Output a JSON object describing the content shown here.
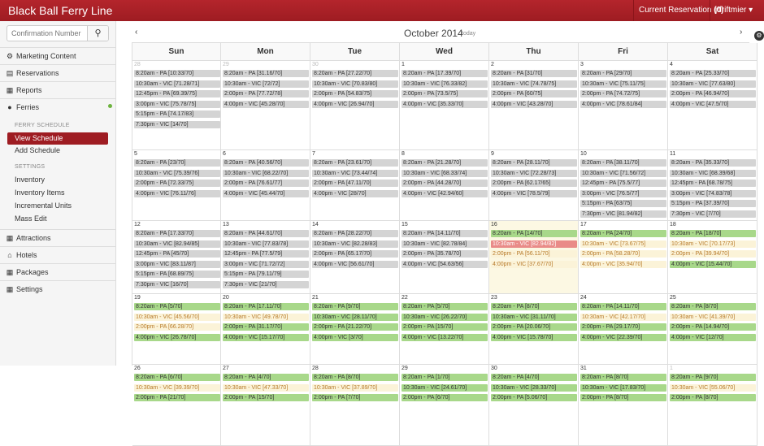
{
  "header": {
    "brand": "Black Ball Ferry Line",
    "reservation_label": "Current Reservation",
    "reservation_count": "(0)",
    "user": "jdriftmier ▾"
  },
  "search": {
    "placeholder": "Confirmation Number"
  },
  "sidebar": {
    "items": [
      {
        "label": "Marketing Content",
        "icon": "gear-icon"
      },
      {
        "label": "Reservations",
        "icon": "list-icon"
      },
      {
        "label": "Reports",
        "icon": "report-icon"
      },
      {
        "label": "Ferries",
        "icon": "drop-icon"
      }
    ],
    "ferry_schedule_heading": "FERRY SCHEDULE",
    "ferry_schedule": [
      "View Schedule",
      "Add Schedule"
    ],
    "settings_heading": "SETTINGS",
    "settings": [
      "Inventory",
      "Inventory Items",
      "Incremental Units",
      "Mass Edit"
    ],
    "bottom_items": [
      {
        "label": "Attractions",
        "icon": "grid-icon"
      },
      {
        "label": "Hotels",
        "icon": "home-icon"
      },
      {
        "label": "Packages",
        "icon": "grid-icon"
      },
      {
        "label": "Settings",
        "icon": "grid-icon"
      }
    ]
  },
  "calendar": {
    "title": "October 2014",
    "today_label": "today",
    "prev": "‹",
    "next": "›",
    "days": [
      "Sun",
      "Mon",
      "Tue",
      "Wed",
      "Thu",
      "Fri",
      "Sat"
    ],
    "weeks": [
      [
        {
          "n": "28",
          "other": true,
          "ev": [
            [
              "8:20am - PA [10:33/70]",
              "g"
            ],
            [
              "10:30am - VIC [71.28/71]",
              "g"
            ],
            [
              "12:45pm - PA [69.39/75]",
              "g"
            ],
            [
              "3:00pm - VIC [75.78/75]",
              "g"
            ],
            [
              "5:15pm - PA [74.17/83]",
              "g"
            ],
            [
              "7:30pm - VIC [14/70]",
              "g"
            ]
          ]
        },
        {
          "n": "29",
          "other": true,
          "ev": [
            [
              "8:20am - PA [31.16/70]",
              "g"
            ],
            [
              "10:30am - VIC [72/72]",
              "g"
            ],
            [
              "2:00pm - PA [77.72/78]",
              "g"
            ],
            [
              "4:00pm - VIC [45.28/70]",
              "g"
            ]
          ]
        },
        {
          "n": "30",
          "other": true,
          "ev": [
            [
              "8:20am - PA [27.22/70]",
              "g"
            ],
            [
              "10:30am - VIC [70.83/80]",
              "g"
            ],
            [
              "2:00pm - PA [54.83/75]",
              "g"
            ],
            [
              "4:00pm - VIC [26.94/70]",
              "g"
            ]
          ]
        },
        {
          "n": "1",
          "ev": [
            [
              "8:20am - PA [17.39/70]",
              "g"
            ],
            [
              "10:30am - VIC [76.33/82]",
              "g"
            ],
            [
              "2:00pm - PA [73.5/75]",
              "g"
            ],
            [
              "4:00pm - VIC [35.33/70]",
              "g"
            ]
          ]
        },
        {
          "n": "2",
          "ev": [
            [
              "8:20am - PA [31/70]",
              "g"
            ],
            [
              "10:30am - VIC [74.78/75]",
              "g"
            ],
            [
              "2:00pm - PA [60/75]",
              "g"
            ],
            [
              "4:00pm - VIC [43.28/70]",
              "g"
            ]
          ]
        },
        {
          "n": "3",
          "ev": [
            [
              "8:20am - PA [29/70]",
              "g"
            ],
            [
              "10:30am - VIC [75.11/75]",
              "g"
            ],
            [
              "2:00pm - PA [74.72/75]",
              "g"
            ],
            [
              "4:00pm - VIC [78.61/84]",
              "g"
            ]
          ]
        },
        {
          "n": "4",
          "ev": [
            [
              "8:20am - PA [25.33/70]",
              "g"
            ],
            [
              "10:30am - VIC [77.63/80]",
              "g"
            ],
            [
              "2:00pm - PA [46.94/70]",
              "g"
            ],
            [
              "4:00pm - VIC [47.5/70]",
              "g"
            ]
          ]
        }
      ],
      [
        {
          "n": "5",
          "ev": [
            [
              "8:20am - PA [23/70]",
              "g"
            ],
            [
              "10:30am - VIC [75.39/76]",
              "g"
            ],
            [
              "2:00pm - PA [72.33/75]",
              "g"
            ],
            [
              "4:00pm - VIC [76.11/76]",
              "g"
            ]
          ]
        },
        {
          "n": "6",
          "ev": [
            [
              "8:20am - PA [40.56/70]",
              "g"
            ],
            [
              "10:30am - VIC [68.22/70]",
              "g"
            ],
            [
              "2:00pm - PA [76.61/77]",
              "g"
            ],
            [
              "4:00pm - VIC [45.44/70]",
              "g"
            ]
          ]
        },
        {
          "n": "7",
          "ev": [
            [
              "8:20am - PA [23.61/70]",
              "g"
            ],
            [
              "10:30am - VIC [73.44/74]",
              "g"
            ],
            [
              "2:00pm - PA [47.11/70]",
              "g"
            ],
            [
              "4:00pm - VIC [28/70]",
              "g"
            ]
          ]
        },
        {
          "n": "8",
          "ev": [
            [
              "8:20am - PA [21.28/70]",
              "g"
            ],
            [
              "10:30am - VIC [68.33/74]",
              "g"
            ],
            [
              "2:00pm - PA [44.28/70]",
              "g"
            ],
            [
              "4:00pm - VIC [42.94/60]",
              "g"
            ]
          ]
        },
        {
          "n": "9",
          "ev": [
            [
              "8:20am - PA [28.11/70]",
              "g"
            ],
            [
              "10:30am - VIC [72.28/73]",
              "g"
            ],
            [
              "2:00pm - PA [62.17/65]",
              "g"
            ],
            [
              "4:00pm - VIC [78.5/79]",
              "g"
            ]
          ]
        },
        {
          "n": "10",
          "ev": [
            [
              "8:20am - PA [38.11/70]",
              "g"
            ],
            [
              "10:30am - VIC [71.56/72]",
              "g"
            ],
            [
              "12:45pm - PA [75.5/77]",
              "g"
            ],
            [
              "3:00pm - VIC [76.5/77]",
              "g"
            ],
            [
              "5:15pm - PA [63/75]",
              "g"
            ],
            [
              "7:30pm - VIC [81.94/82]",
              "g"
            ]
          ]
        },
        {
          "n": "11",
          "ev": [
            [
              "8:20am - PA [35.33/70]",
              "g"
            ],
            [
              "10:30am - VIC [68.39/68]",
              "g"
            ],
            [
              "12:45pm - PA [68.78/75]",
              "g"
            ],
            [
              "3:00pm - VIC [74.83/78]",
              "g"
            ],
            [
              "5:15pm - PA [37.39/70]",
              "g"
            ],
            [
              "7:30pm - VIC [7/70]",
              "g"
            ]
          ]
        }
      ],
      [
        {
          "n": "12",
          "ev": [
            [
              "8:20am - PA [17.33/70]",
              "g"
            ],
            [
              "10:30am - VIC [82.94/85]",
              "g"
            ],
            [
              "12:45pm - PA [45/70]",
              "g"
            ],
            [
              "3:00pm - VIC [83.11/87]",
              "g"
            ],
            [
              "5:15pm - PA [68.89/75]",
              "g"
            ],
            [
              "7:30pm - VIC [16/70]",
              "g"
            ]
          ]
        },
        {
          "n": "13",
          "ev": [
            [
              "8:20am - PA [44.61/70]",
              "g"
            ],
            [
              "10:30am - VIC [77.83/78]",
              "g"
            ],
            [
              "12:45pm - PA [77.5/79]",
              "g"
            ],
            [
              "3:00pm - VIC [71.72/72]",
              "g"
            ],
            [
              "5:15pm - PA [79.11/79]",
              "g"
            ],
            [
              "7:30pm - VIC [21/70]",
              "g"
            ]
          ]
        },
        {
          "n": "14",
          "ev": [
            [
              "8:20am - PA [28.22/70]",
              "g"
            ],
            [
              "10:30am - VIC [82.28/83]",
              "g"
            ],
            [
              "2:00pm - PA [65.17/70]",
              "g"
            ],
            [
              "4:00pm - VIC [56.61/70]",
              "g"
            ]
          ]
        },
        {
          "n": "15",
          "ev": [
            [
              "8:20am - PA [14.11/70]",
              "g"
            ],
            [
              "10:30am - VIC [82.78/84]",
              "g"
            ],
            [
              "2:00pm - PA [35.78/70]",
              "g"
            ],
            [
              "4:00pm - VIC [54.63/56]",
              "g"
            ]
          ]
        },
        {
          "n": "16",
          "today": true,
          "ev": [
            [
              "8:20am - PA [14/70]",
              "gr"
            ],
            [
              "10:30am - VIC [82.94/82]",
              "r"
            ],
            [
              "2:00pm - PA [56.11/70]",
              "c"
            ],
            [
              "4:00pm - VIC [37.67/70]",
              "c"
            ]
          ]
        },
        {
          "n": "17",
          "ev": [
            [
              "8:20am - PA [24/70]",
              "gr"
            ],
            [
              "10:30am - VIC [73.67/75]",
              "c"
            ],
            [
              "2:00pm - PA [58.28/70]",
              "c"
            ],
            [
              "4:00pm - VIC [35.94/70]",
              "c"
            ]
          ]
        },
        {
          "n": "18",
          "ev": [
            [
              "8:20am - PA [18/70]",
              "gr"
            ],
            [
              "10:30am - VIC [70.17/73]",
              "c"
            ],
            [
              "2:00pm - PA [39.94/70]",
              "c"
            ],
            [
              "4:00pm - VIC [15.44/70]",
              "gr"
            ]
          ]
        }
      ],
      [
        {
          "n": "19",
          "ev": [
            [
              "8:20am - PA [5/70]",
              "gr"
            ],
            [
              "10:30am - VIC [45.56/70]",
              "c"
            ],
            [
              "2:00pm - PA [66.28/70]",
              "c"
            ],
            [
              "4:00pm - VIC [26.78/70]",
              "gr"
            ]
          ]
        },
        {
          "n": "20",
          "ev": [
            [
              "8:20am - PA [17.11/70]",
              "gr"
            ],
            [
              "10:30am - VIC [49.78/70]",
              "c"
            ],
            [
              "2:00pm - PA [31.17/70]",
              "gr"
            ],
            [
              "4:00pm - VIC [15.17/70]",
              "gr"
            ]
          ]
        },
        {
          "n": "21",
          "ev": [
            [
              "8:20am - PA [9/70]",
              "gr"
            ],
            [
              "10:30am - VIC [28.11/70]",
              "gr"
            ],
            [
              "2:00pm - PA [21.22/70]",
              "gr"
            ],
            [
              "4:00pm - VIC [3/70]",
              "gr"
            ]
          ]
        },
        {
          "n": "22",
          "ev": [
            [
              "8:20am - PA [5/70]",
              "gr"
            ],
            [
              "10:30am - VIC [26.22/70]",
              "gr"
            ],
            [
              "2:00pm - PA [15/70]",
              "gr"
            ],
            [
              "4:00pm - VIC [13.22/70]",
              "gr"
            ]
          ]
        },
        {
          "n": "23",
          "ev": [
            [
              "8:20am - PA [8/70]",
              "gr"
            ],
            [
              "10:30am - VIC [31.11/70]",
              "gr"
            ],
            [
              "2:00pm - PA [20.06/70]",
              "gr"
            ],
            [
              "4:00pm - VIC [15.78/70]",
              "gr"
            ]
          ]
        },
        {
          "n": "24",
          "ev": [
            [
              "8:20am - PA [14.11/70]",
              "gr"
            ],
            [
              "10:30am - VIC [42.17/70]",
              "c"
            ],
            [
              "2:00pm - PA [29.17/70]",
              "gr"
            ],
            [
              "4:00pm - VIC [22.39/70]",
              "gr"
            ]
          ]
        },
        {
          "n": "25",
          "ev": [
            [
              "8:20am - PA [8/70]",
              "gr"
            ],
            [
              "10:30am - VIC [41.39/70]",
              "c"
            ],
            [
              "2:00pm - PA [14.94/70]",
              "gr"
            ],
            [
              "4:00pm - VIC [12/70]",
              "gr"
            ]
          ]
        }
      ],
      [
        {
          "n": "26",
          "ev": [
            [
              "8:20am - PA [6/70]",
              "gr"
            ],
            [
              "10:30am - VIC [39.39/70]",
              "c"
            ],
            [
              "2:00pm - PA [21/70]",
              "gr"
            ]
          ]
        },
        {
          "n": "27",
          "ev": [
            [
              "8:20am - PA [4/70]",
              "gr"
            ],
            [
              "10:30am - VIC [47.33/70]",
              "c"
            ],
            [
              "2:00pm - PA [15/70]",
              "gr"
            ]
          ]
        },
        {
          "n": "28",
          "ev": [
            [
              "8:20am - PA [8/70]",
              "gr"
            ],
            [
              "10:30am - VIC [37.89/70]",
              "c"
            ],
            [
              "2:00pm - PA [7/70]",
              "gr"
            ]
          ]
        },
        {
          "n": "29",
          "ev": [
            [
              "8:20am - PA [1/70]",
              "gr"
            ],
            [
              "10:30am - VIC [24.61/70]",
              "gr"
            ],
            [
              "2:00pm - PA [6/70]",
              "gr"
            ]
          ]
        },
        {
          "n": "30",
          "ev": [
            [
              "8:20am - PA [4/70]",
              "gr"
            ],
            [
              "10:30am - VIC [28.33/70]",
              "gr"
            ],
            [
              "2:00pm - PA [5.06/70]",
              "gr"
            ]
          ]
        },
        {
          "n": "31",
          "ev": [
            [
              "8:20am - PA [8/70]",
              "gr"
            ],
            [
              "10:30am - VIC [17.83/70]",
              "gr"
            ],
            [
              "2:00pm - PA [8/70]",
              "gr"
            ]
          ]
        },
        {
          "n": "1",
          "other": true,
          "ev": [
            [
              "8:20am - PA [9/70]",
              "gr"
            ],
            [
              "10:30am - VIC [55.06/70]",
              "c"
            ],
            [
              "2:00pm - PA [8/70]",
              "gr"
            ]
          ]
        }
      ]
    ]
  }
}
